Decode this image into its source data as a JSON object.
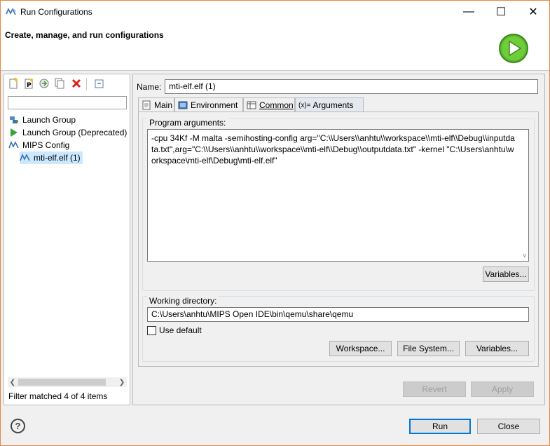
{
  "window": {
    "title": "Run Configurations",
    "minimize": "—",
    "maximize": "☐",
    "close": "✕"
  },
  "header": {
    "title": "Create, manage, and run configurations"
  },
  "left": {
    "tree": [
      {
        "label": "Launch Group",
        "icon": "launch-group-icon"
      },
      {
        "label": "Launch Group (Deprecated)",
        "icon": "run-arrow-icon"
      },
      {
        "label": "MIPS Config",
        "icon": "mips-icon"
      },
      {
        "label": "mti-elf.elf (1)",
        "icon": "mips-icon",
        "selected": true
      }
    ],
    "filter_text": "Filter matched 4 of 4 items",
    "filter_placeholder": ""
  },
  "right": {
    "name_label": "Name:",
    "name_value": "mti-elf.elf (1)",
    "tabs": [
      {
        "label": "Main",
        "icon": "main-tab-icon"
      },
      {
        "label": "Environment",
        "icon": "environment-tab-icon"
      },
      {
        "label": "Common",
        "icon": "common-tab-icon"
      },
      {
        "label": "Arguments",
        "icon": "arguments-tab-icon",
        "prefix": "(x)=",
        "active": true
      }
    ],
    "program_arguments_label": "Program arguments:",
    "program_arguments": "-cpu 34Kf -M malta -semihosting-config arg=\"C:\\\\Users\\\\anhtu\\\\workspace\\\\mti-elf\\\\Debug\\\\inputdata.txt\",arg=\"C:\\\\Users\\\\anhtu\\\\workspace\\\\mti-elf\\\\Debug\\\\outputdata.txt\" -kernel \"C:\\Users\\anhtu\\workspace\\mti-elf\\Debug\\mti-elf.elf\"",
    "variables_label": "Variables...",
    "working_directory_label": "Working directory:",
    "working_directory": "C:\\Users\\anhtu\\MIPS Open IDE\\bin\\qemu\\share\\qemu",
    "use_default_label": "Use default",
    "use_default_checked": false,
    "workspace_label": "Workspace...",
    "file_system_label": "File System...",
    "variables2_label": "Variables...",
    "revert_label": "Revert",
    "apply_label": "Apply"
  },
  "footer": {
    "run_label": "Run",
    "close_label": "Close",
    "help_label": "?"
  }
}
